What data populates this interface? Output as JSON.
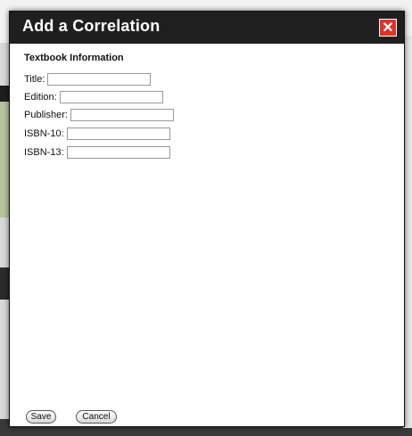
{
  "dialog": {
    "title": "Add a Correlation",
    "close_label": "✕"
  },
  "section": {
    "heading": "Textbook Information"
  },
  "fields": [
    {
      "label": "Title:",
      "value": ""
    },
    {
      "label": "Edition:",
      "value": ""
    },
    {
      "label": "Publisher:",
      "value": ""
    },
    {
      "label": "ISBN-10:",
      "value": ""
    },
    {
      "label": "ISBN-13:",
      "value": ""
    }
  ],
  "buttons": {
    "save_label": "Save",
    "cancel_label": "Cancel"
  },
  "colors": {
    "titlebar": "#1f1f1f",
    "close": "#d9352b"
  }
}
